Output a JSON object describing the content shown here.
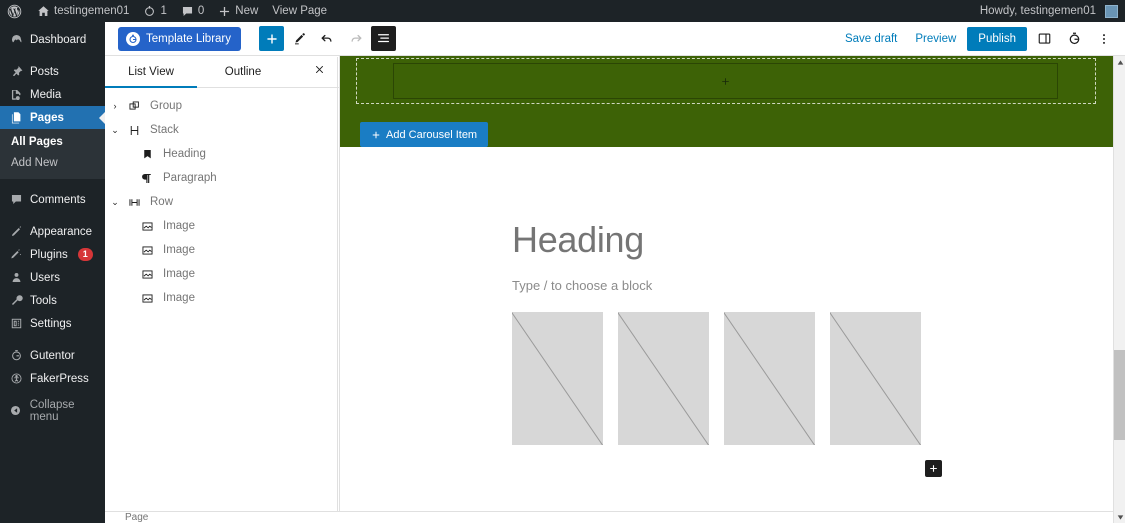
{
  "adminbar": {
    "logo_icon": "wordpress-logo-icon",
    "site_name": "testingemen01",
    "site_icon": "home-icon",
    "revisions_icon": "updates-icon",
    "revisions_count": "1",
    "comments_icon": "comment-bubble-icon",
    "comments_count": "0",
    "new_icon": "plus-icon",
    "new_label": "New",
    "view_page_label": "View Page",
    "howdy_label": "Howdy, testingemen01",
    "avatar_icon": "user-avatar"
  },
  "adminmenu": {
    "items": [
      {
        "label": "Dashboard",
        "icon": "dashboard-icon",
        "current": false
      },
      {
        "label": "Posts",
        "icon": "pin-icon",
        "current": false
      },
      {
        "label": "Media",
        "icon": "media-icon",
        "current": false
      },
      {
        "label": "Pages",
        "icon": "pages-icon",
        "current": true
      },
      {
        "label": "Comments",
        "icon": "comment-icon",
        "current": false
      },
      {
        "label": "Appearance",
        "icon": "brush-icon",
        "current": false
      },
      {
        "label": "Plugins",
        "icon": "plugin-icon",
        "current": false,
        "badge": "1"
      },
      {
        "label": "Users",
        "icon": "users-icon",
        "current": false
      },
      {
        "label": "Tools",
        "icon": "wrench-icon",
        "current": false
      },
      {
        "label": "Settings",
        "icon": "settings-icon",
        "current": false
      },
      {
        "label": "Gutentor",
        "icon": "gutentor-icon",
        "current": false
      },
      {
        "label": "FakerPress",
        "icon": "fakerpress-icon",
        "current": false
      },
      {
        "label": "Collapse menu",
        "icon": "collapse-icon",
        "current": false
      }
    ],
    "submenu": [
      {
        "label": "All Pages",
        "current": true
      },
      {
        "label": "Add New",
        "current": false
      }
    ]
  },
  "header": {
    "template_library_label": "Template Library",
    "template_library_icon": "gutentor-icon",
    "add_block_icon": "plus-icon",
    "tools_icon": "pencil-icon",
    "undo_icon": "undo-arrow-icon",
    "redo_icon": "redo-arrow-icon",
    "list_view_icon": "list-view-icon",
    "save_draft_label": "Save draft",
    "preview_label": "Preview",
    "publish_label": "Publish",
    "settings_sidebar_icon": "sidebar-panel-icon",
    "gutentor_icon": "gutentor-icon",
    "options_icon": "ellipsis-vertical-icon"
  },
  "listview": {
    "tabs": [
      {
        "label": "List View",
        "active": true
      },
      {
        "label": "Outline",
        "active": false
      }
    ],
    "close_icon": "close-icon",
    "blocks": [
      {
        "label": "Group",
        "icon": "group-block-icon",
        "chevron": "›",
        "indent": false
      },
      {
        "label": "Stack",
        "icon": "stack-block-icon",
        "chevron": "⌄",
        "indent": false
      },
      {
        "label": "Heading",
        "icon": "heading-block-icon",
        "chevron": "",
        "indent": true
      },
      {
        "label": "Paragraph",
        "icon": "paragraph-block-icon",
        "chevron": "",
        "indent": true
      },
      {
        "label": "Row",
        "icon": "row-block-icon",
        "chevron": "⌄",
        "indent": false
      },
      {
        "label": "Image",
        "icon": "image-block-icon",
        "chevron": "",
        "indent": true
      },
      {
        "label": "Image",
        "icon": "image-block-icon",
        "chevron": "",
        "indent": true
      },
      {
        "label": "Image",
        "icon": "image-block-icon",
        "chevron": "",
        "indent": true
      },
      {
        "label": "Image",
        "icon": "image-block-icon",
        "chevron": "",
        "indent": true
      }
    ]
  },
  "canvas": {
    "green_section_color": "#3d6206",
    "carousel_placeholder_icon": "plus-icon",
    "add_carousel_label": "Add Carousel Item",
    "add_carousel_icon": "plus-icon",
    "heading_placeholder": "Heading",
    "paragraph_placeholder": "Type / to choose a block",
    "image_count": 4,
    "appender_icon": "plus-icon"
  },
  "scrollbar": {
    "up_icon": "caret-up-icon",
    "down_icon": "caret-down-icon"
  },
  "bottombar": {
    "breadcrumb_label": "Page"
  }
}
